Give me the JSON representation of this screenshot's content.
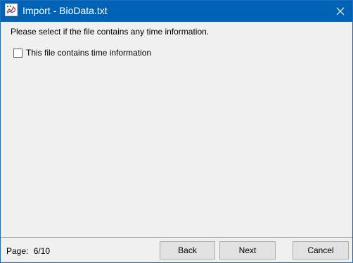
{
  "window": {
    "title": "Import - BioData.txt",
    "app_icon": "chart-document-icon",
    "close_icon": "close-icon"
  },
  "content": {
    "prompt": "Please select if the file contains any time information.",
    "checkbox": {
      "label": "This file contains time information",
      "checked": false
    }
  },
  "footer": {
    "page_label": "Page:",
    "page_value": "6/10",
    "back_label": "Back",
    "next_label": "Next",
    "cancel_label": "Cancel"
  },
  "colors": {
    "titlebar": "#0062b5",
    "window_bg": "#f0f0f0",
    "checkbox_border": "#2f6fb5",
    "button_bg": "#e1e1e1"
  }
}
